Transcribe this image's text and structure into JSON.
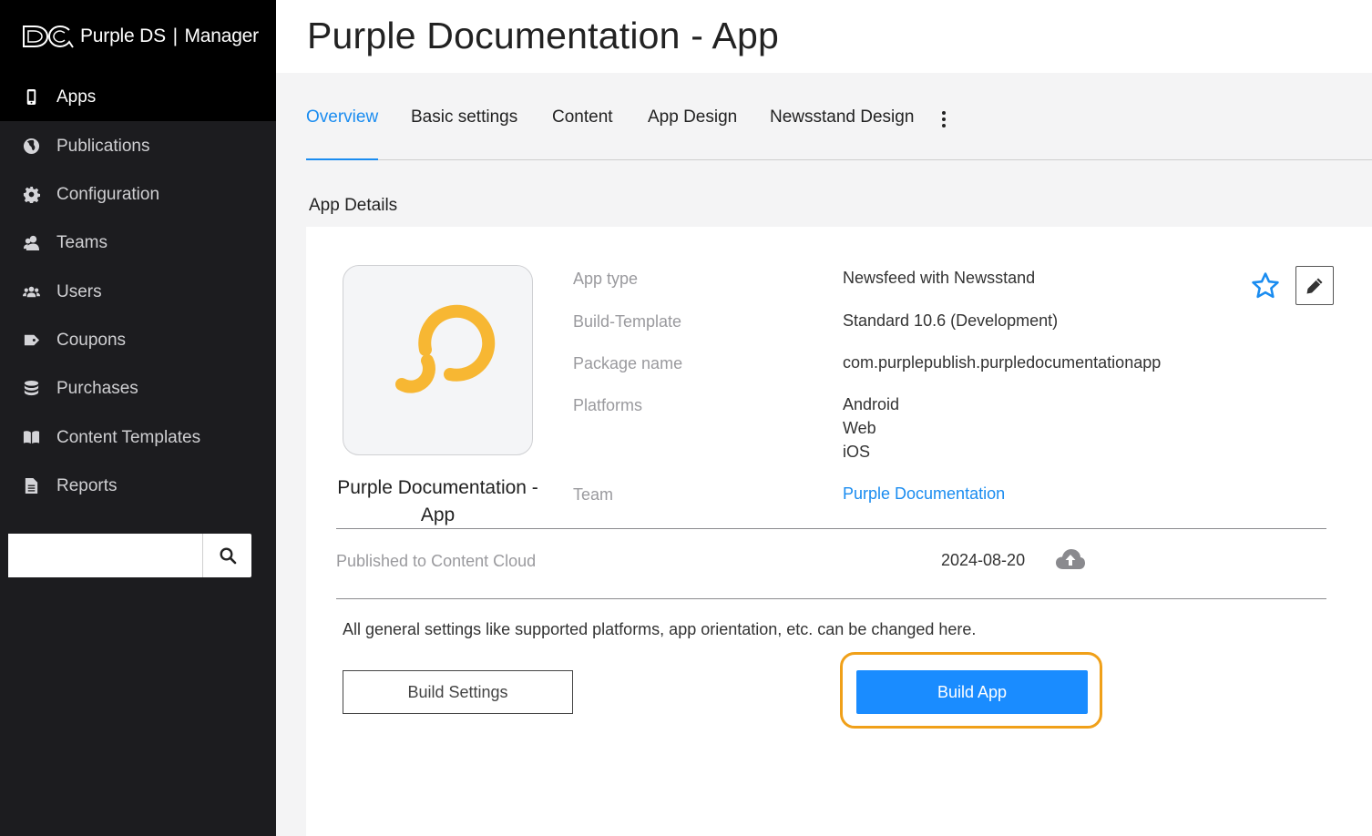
{
  "brand": {
    "name": "Purple DS",
    "separator": "|",
    "product": "Manager"
  },
  "sidebar": {
    "items": [
      {
        "label": "Apps",
        "icon": "mobile-icon",
        "active": true
      },
      {
        "label": "Publications",
        "icon": "globe-icon",
        "active": false
      },
      {
        "label": "Configuration",
        "icon": "gear-icon",
        "active": false
      },
      {
        "label": "Teams",
        "icon": "team-icon",
        "active": false
      },
      {
        "label": "Users",
        "icon": "users-icon",
        "active": false
      },
      {
        "label": "Coupons",
        "icon": "tag-icon",
        "active": false
      },
      {
        "label": "Purchases",
        "icon": "database-icon",
        "active": false
      },
      {
        "label": "Content Templates",
        "icon": "book-icon",
        "active": false
      },
      {
        "label": "Reports",
        "icon": "file-icon",
        "active": false
      }
    ],
    "search": {
      "value": "",
      "placeholder": ""
    }
  },
  "header": {
    "title": "Purple Documentation - App"
  },
  "tabs": [
    {
      "label": "Overview",
      "active": true
    },
    {
      "label": "Basic settings",
      "active": false
    },
    {
      "label": "Content",
      "active": false
    },
    {
      "label": "App Design",
      "active": false
    },
    {
      "label": "Newsstand Design",
      "active": false
    }
  ],
  "section": {
    "title": "App Details"
  },
  "app": {
    "name": "Purple Documentation - App",
    "details": {
      "app_type_label": "App type",
      "app_type_value": "Newsfeed with Newsstand",
      "build_template_label": "Build-Template",
      "build_template_value": "Standard 10.6 (Development)",
      "package_label": "Package name",
      "package_value": "com.purplepublish.purpledocumentationapp",
      "platforms_label": "Platforms",
      "platforms": [
        "Android",
        "Web",
        "iOS"
      ],
      "team_label": "Team",
      "team_value": "Purple Documentation"
    },
    "published_label": "Published to Content Cloud",
    "published_date": "2024-08-20",
    "info_text": "All general settings like supported platforms, app orientation, etc. can be changed here.",
    "build_settings_label": "Build Settings",
    "build_app_label": "Build App"
  },
  "colors": {
    "accent": "#1a8cf0",
    "button_primary": "#1a8cff",
    "highlight": "#f0a019",
    "logo": "#f7b733",
    "sidebar_bg": "#1c1c1f"
  }
}
